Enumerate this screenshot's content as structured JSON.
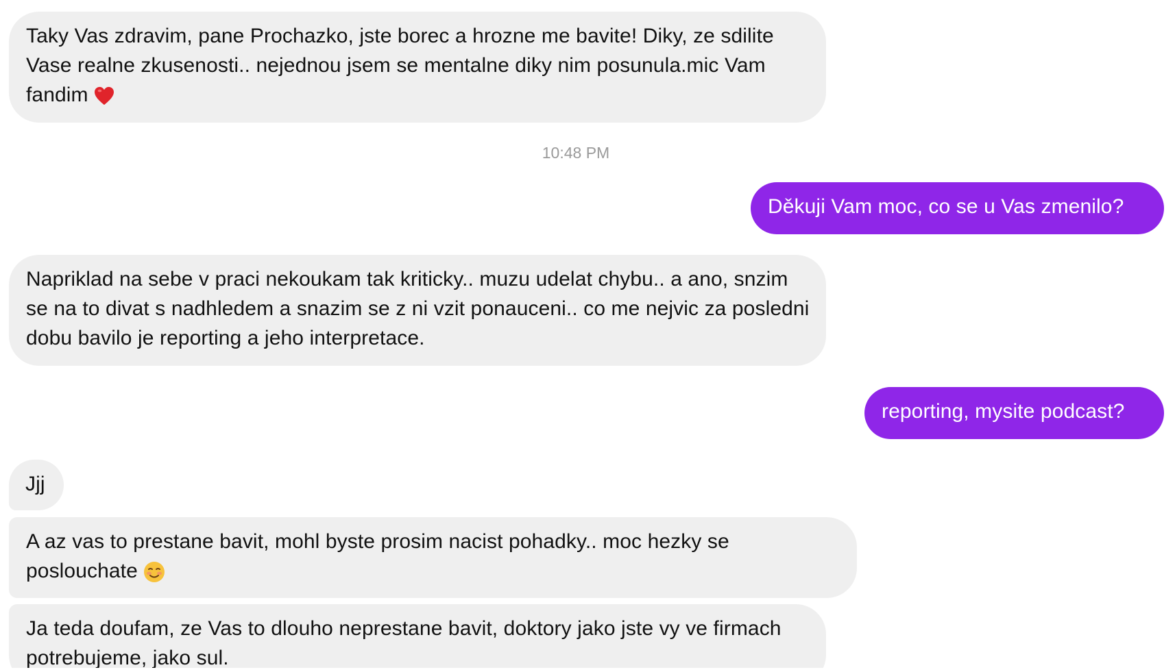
{
  "conversation": {
    "messages": [
      {
        "sender": "them",
        "text": "Taky Vas zdravim, pane Prochazko, jste borec a hrozne me bavite! Diky, ze sdilite Vase realne zkusenosti.. nejednou jsem se mentalne diky nim posunula.mic Vam fandim",
        "emoji": "red-heart"
      },
      {
        "sender": "me",
        "text": "Děkuji Vam moc, co se u Vas zmenilo?"
      },
      {
        "sender": "them",
        "text": "Napriklad na sebe v praci nekoukam tak kriticky.. muzu udelat chybu.. a ano, snzim se na to divat s nadhledem a snazim se z ni vzit ponauceni.. co me nejvic za posledni dobu bavilo je reporting a jeho interpretace."
      },
      {
        "sender": "me",
        "text": "reporting, mysite podcast?"
      },
      {
        "sender": "them",
        "text": "Jjj"
      },
      {
        "sender": "them",
        "text": "A az vas to prestane bavit, mohl byste prosim nacist pohadky.. moc hezky se poslouchate",
        "emoji": "smiling-face"
      },
      {
        "sender": "them",
        "text": "Ja teda doufam, ze Vas to dlouho neprestane bavit, doktory jako jste vy ve firmach potrebujeme, jako sul."
      }
    ],
    "timestamp": "10:48 PM"
  },
  "colors": {
    "incoming_bubble": "#efefef",
    "outgoing_bubble": "#8f26e8",
    "timestamp_text": "#9a9a9a"
  }
}
